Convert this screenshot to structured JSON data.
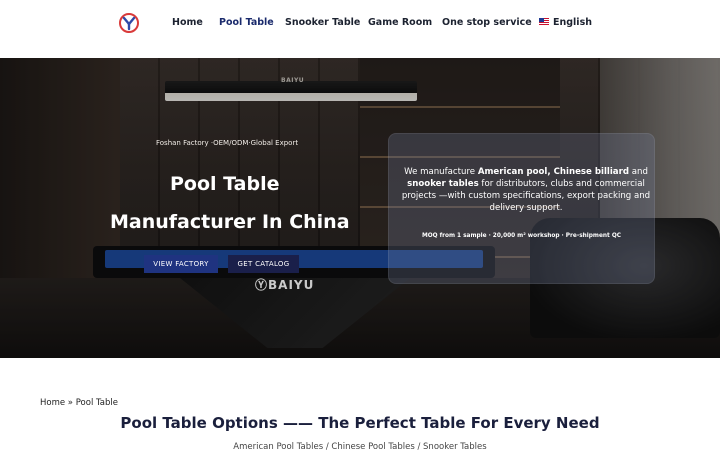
{
  "header": {
    "nav": [
      {
        "label": "Home"
      },
      {
        "label": "Pool Table"
      },
      {
        "label": "Snooker Table"
      },
      {
        "label": "Game Room"
      },
      {
        "label": "One stop service"
      },
      {
        "label": "English"
      }
    ]
  },
  "hero": {
    "lamp_brand": "BAIYU",
    "tagline": "Foshan Factory ·OEM/ODM·Global Export",
    "title_line1": "Pool Table",
    "title_line2": "Manufacturer In China",
    "buttons": {
      "view_factory": "VIEW FACTORY",
      "get_catalog": "GET CATALOG"
    },
    "table_brand": "BAIYU",
    "card": {
      "p1": "We manufacture ",
      "b1": "American pool, Chinese billiard",
      "p2": " and ",
      "b2": "snooker tables",
      "p3": " for distributors, clubs and commercial projects —with custom specifications, export packing and delivery support.",
      "stats": "MOQ from 1 sample · 20,000 m² workshop · Pre-shipment QC"
    }
  },
  "breadcrumb": {
    "home": "Home",
    "separator": " » ",
    "current": "Pool Table"
  },
  "section": {
    "title": "Pool Table Options —— The Perfect Table For Every Need",
    "subtitle": "American Pool Tables / Chinese Pool Tables / Snooker Tables"
  },
  "colors": {
    "brand_blue": "#1f3380",
    "dark_navy": "#1a1f4a",
    "logo_red": "#d93a3a",
    "logo_blue": "#2f4aa8"
  }
}
